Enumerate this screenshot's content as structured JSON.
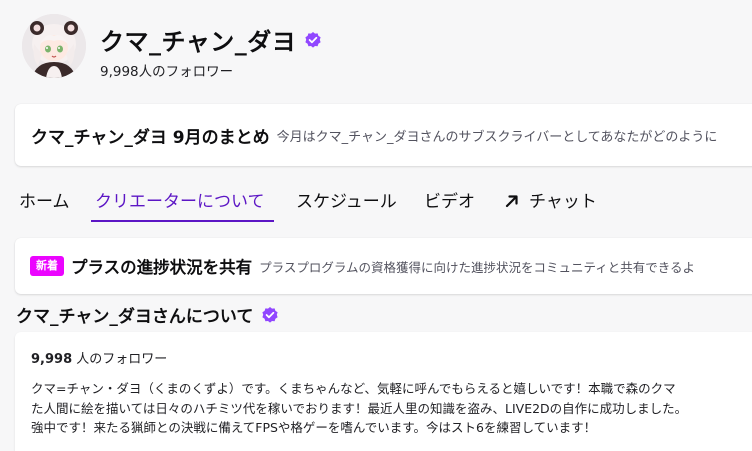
{
  "channel": {
    "name": "クマ_チャン_ダヨ",
    "followers": "9,998人のフォロワー",
    "verified_icon": "verified-badge-icon",
    "accent_color": "#9147ff"
  },
  "recap": {
    "title": "クマ_チャン_ダヨ 9月のまとめ",
    "description": "今月はクマ_チャン_ダヨさんのサブスクライバーとしてあなたがどのように"
  },
  "tabs": [
    {
      "label": "ホーム"
    },
    {
      "label": "クリエーターについて",
      "active": true
    },
    {
      "label": "スケジュール"
    },
    {
      "label": "ビデオ"
    },
    {
      "label": "チャット",
      "icon": "external-arrow-icon"
    }
  ],
  "plus": {
    "badge": "新着",
    "badge_color": "#eb04ff",
    "title": "プラスの進捗状況を共有",
    "description": "プラスプログラムの資格獲得に向けた進捗状況をコミュニティと共有できるよ"
  },
  "about": {
    "heading": "クマ_チャン_ダヨさんについて",
    "follower_count": "9,998",
    "follower_suffix": "人のフォロワー",
    "bio_lines": [
      "クマ=チャン・ダヨ（くまのくずよ）です。くまちゃんなど、気軽に呼んでもらえると嬉しいです！本職で森のクマ",
      "た人間に絵を描いては日々のハチミツ代を稼いでおります！最近人里の知識を盗み、LIVE2Dの自作に成功しました。",
      "強中です！来たる猟師との決戦に備えてFPSや格ゲーを嗜んでいます。今はスト6を練習しています！"
    ]
  }
}
